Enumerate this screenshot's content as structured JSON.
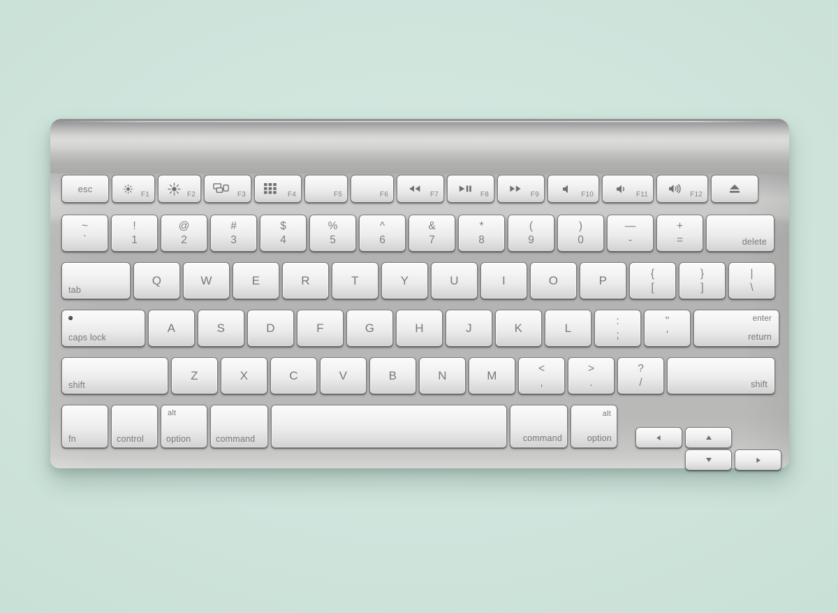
{
  "scene": {
    "background_color": "#cfe5dd",
    "device_name": "apple-wireless-keyboard"
  },
  "keyboard": {
    "chassis_color": "#b4b4b3",
    "key_face_color": "#f2f2f2",
    "key_text_color": "#777879",
    "rows": {
      "function_row": [
        {
          "name": "esc",
          "label": "esc",
          "style": "word-center"
        },
        {
          "name": "f1",
          "label": "F1",
          "icon": "brightness-down-icon",
          "style": "fkey"
        },
        {
          "name": "f2",
          "label": "F2",
          "icon": "brightness-up-icon",
          "style": "fkey"
        },
        {
          "name": "f3",
          "label": "F3",
          "icon": "mission-control-icon",
          "style": "fkey"
        },
        {
          "name": "f4",
          "label": "F4",
          "icon": "launchpad-icon",
          "style": "fkey"
        },
        {
          "name": "f5",
          "label": "F5",
          "icon": "none",
          "style": "fkey"
        },
        {
          "name": "f6",
          "label": "F6",
          "icon": "none",
          "style": "fkey"
        },
        {
          "name": "f7",
          "label": "F7",
          "icon": "rewind-icon",
          "style": "fkey"
        },
        {
          "name": "f8",
          "label": "F8",
          "icon": "play-pause-icon",
          "style": "fkey"
        },
        {
          "name": "f9",
          "label": "F9",
          "icon": "fast-forward-icon",
          "style": "fkey"
        },
        {
          "name": "f10",
          "label": "F10",
          "icon": "volume-mute-icon",
          "style": "fkey"
        },
        {
          "name": "f11",
          "label": "F11",
          "icon": "volume-down-icon",
          "style": "fkey"
        },
        {
          "name": "f12",
          "label": "F12",
          "icon": "volume-up-icon",
          "style": "fkey"
        },
        {
          "name": "eject",
          "label": "",
          "icon": "eject-icon",
          "style": "icon-center"
        }
      ],
      "number_row": [
        {
          "name": "backtick",
          "upper": "~",
          "lower": "`"
        },
        {
          "name": "digit-1",
          "upper": "!",
          "lower": "1"
        },
        {
          "name": "digit-2",
          "upper": "@",
          "lower": "2"
        },
        {
          "name": "digit-3",
          "upper": "#",
          "lower": "3"
        },
        {
          "name": "digit-4",
          "upper": "$",
          "lower": "4"
        },
        {
          "name": "digit-5",
          "upper": "%",
          "lower": "5"
        },
        {
          "name": "digit-6",
          "upper": "^",
          "lower": "6"
        },
        {
          "name": "digit-7",
          "upper": "&",
          "lower": "7"
        },
        {
          "name": "digit-8",
          "upper": "*",
          "lower": "8"
        },
        {
          "name": "digit-9",
          "upper": "(",
          "lower": "9"
        },
        {
          "name": "digit-0",
          "upper": ")",
          "lower": "0"
        },
        {
          "name": "minus",
          "upper": "—",
          "lower": "-"
        },
        {
          "name": "equals",
          "upper": "+",
          "lower": "="
        },
        {
          "name": "delete",
          "label": "delete",
          "style": "word-bottom-right"
        }
      ],
      "top_row": [
        {
          "name": "tab",
          "label": "tab",
          "style": "word-bottom-left"
        },
        {
          "name": "key-q",
          "label": "Q"
        },
        {
          "name": "key-w",
          "label": "W"
        },
        {
          "name": "key-e",
          "label": "E"
        },
        {
          "name": "key-r",
          "label": "R"
        },
        {
          "name": "key-t",
          "label": "T"
        },
        {
          "name": "key-y",
          "label": "Y"
        },
        {
          "name": "key-u",
          "label": "U"
        },
        {
          "name": "key-i",
          "label": "I"
        },
        {
          "name": "key-o",
          "label": "O"
        },
        {
          "name": "key-p",
          "label": "P"
        },
        {
          "name": "bracket-left",
          "upper": "{",
          "lower": "["
        },
        {
          "name": "bracket-right",
          "upper": "}",
          "lower": "]"
        },
        {
          "name": "backslash",
          "upper": "|",
          "lower": "\\"
        }
      ],
      "home_row": [
        {
          "name": "caps-lock",
          "label": "caps lock",
          "style": "word-bottom-left",
          "indicator": true
        },
        {
          "name": "key-a",
          "label": "A"
        },
        {
          "name": "key-s",
          "label": "S"
        },
        {
          "name": "key-d",
          "label": "D"
        },
        {
          "name": "key-f",
          "label": "F"
        },
        {
          "name": "key-g",
          "label": "G"
        },
        {
          "name": "key-h",
          "label": "H"
        },
        {
          "name": "key-j",
          "label": "J"
        },
        {
          "name": "key-k",
          "label": "K"
        },
        {
          "name": "key-l",
          "label": "L"
        },
        {
          "name": "semicolon",
          "upper": ":",
          "lower": ";"
        },
        {
          "name": "quote",
          "upper": "\"",
          "lower": "'"
        },
        {
          "name": "return",
          "label_top": "enter",
          "label_bottom": "return",
          "style": "enter-return"
        }
      ],
      "bottom_letter_row": [
        {
          "name": "shift-left",
          "label": "shift",
          "style": "word-bottom-left"
        },
        {
          "name": "key-z",
          "label": "Z"
        },
        {
          "name": "key-x",
          "label": "X"
        },
        {
          "name": "key-c",
          "label": "C"
        },
        {
          "name": "key-v",
          "label": "V"
        },
        {
          "name": "key-b",
          "label": "B"
        },
        {
          "name": "key-n",
          "label": "N"
        },
        {
          "name": "key-m",
          "label": "M"
        },
        {
          "name": "comma",
          "upper": "<",
          "lower": ","
        },
        {
          "name": "period",
          "upper": ">",
          "lower": "."
        },
        {
          "name": "slash",
          "upper": "?",
          "lower": "/"
        },
        {
          "name": "shift-right",
          "label": "shift",
          "style": "word-bottom-right"
        }
      ],
      "modifier_row": [
        {
          "name": "fn",
          "label": "fn",
          "style": "word-bottom-left"
        },
        {
          "name": "control",
          "label": "control",
          "style": "word-bottom-left"
        },
        {
          "name": "option-left",
          "label": "option",
          "label_top": "alt",
          "style": "alt-option-left"
        },
        {
          "name": "command-left",
          "label": "command",
          "style": "word-bottom-left"
        },
        {
          "name": "space",
          "label": "",
          "style": "spacebar"
        },
        {
          "name": "command-right",
          "label": "command",
          "style": "word-bottom-right"
        },
        {
          "name": "option-right",
          "label": "option",
          "label_top": "alt",
          "style": "alt-option-right"
        }
      ],
      "arrow_cluster": [
        {
          "name": "arrow-left",
          "icon": "arrow-left-icon"
        },
        {
          "name": "arrow-up",
          "icon": "arrow-up-icon"
        },
        {
          "name": "arrow-down",
          "icon": "arrow-down-icon"
        },
        {
          "name": "arrow-right",
          "icon": "arrow-right-icon"
        }
      ]
    }
  }
}
